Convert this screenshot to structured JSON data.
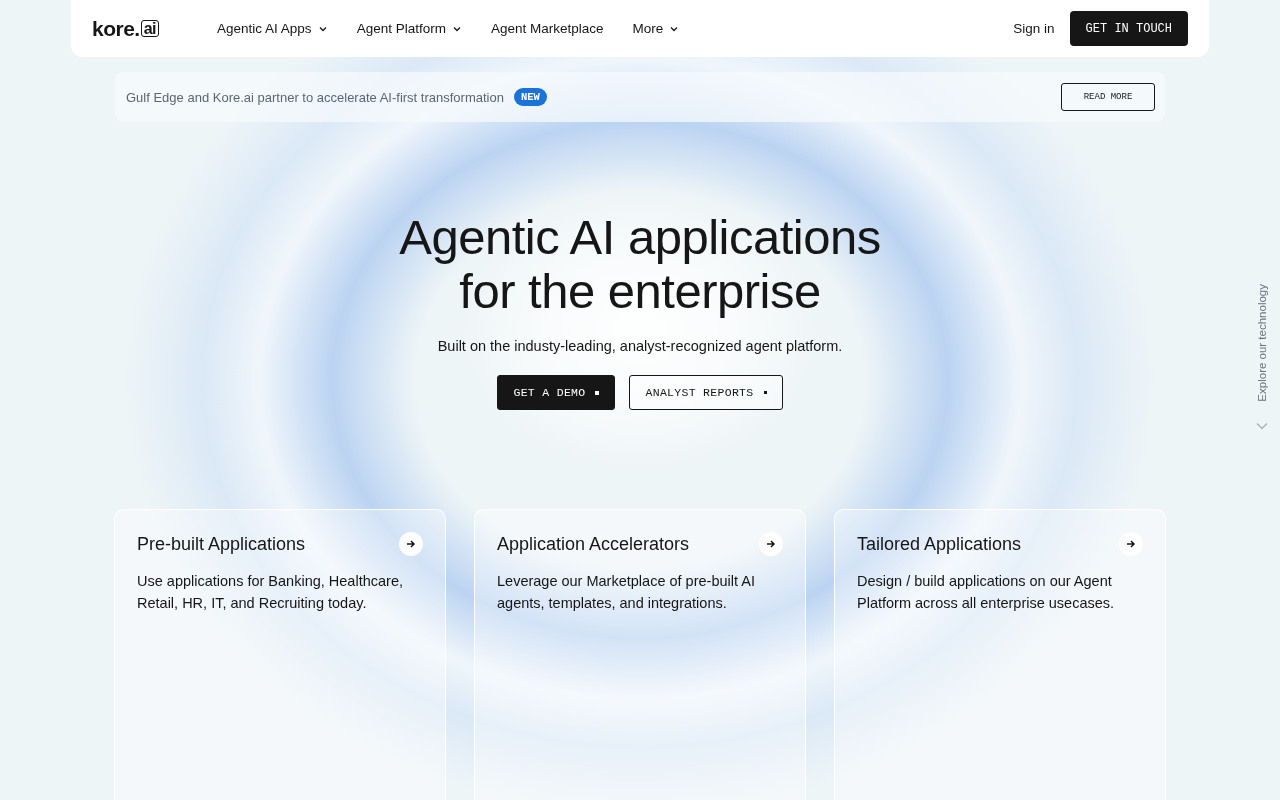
{
  "nav": {
    "logo": {
      "word": "kore.",
      "badge": "ai"
    },
    "links": [
      {
        "label": "Agentic AI Apps",
        "dropdown": true
      },
      {
        "label": "Agent Platform",
        "dropdown": true
      },
      {
        "label": "Agent Marketplace",
        "dropdown": false
      },
      {
        "label": "More",
        "dropdown": true
      }
    ],
    "sign_in": "Sign in",
    "cta": "GET IN TOUCH"
  },
  "announcement": {
    "text": "Gulf Edge and Kore.ai partner to accelerate AI-first transformation",
    "badge": "NEW",
    "button": "READ MORE"
  },
  "hero": {
    "title_lines": [
      "Agentic AI applications",
      "for the enterprise"
    ],
    "subtitle": "Built on the industy-leading, analyst-recognized agent platform.",
    "buttons": [
      {
        "label": "GET A DEMO",
        "kind": "primary"
      },
      {
        "label": "ANALYST REPORTS",
        "kind": "outline"
      }
    ]
  },
  "side_link": "Explore our technology",
  "cards": [
    {
      "title": "Pre-built Applications",
      "text": "Use applications for Banking, Healthcare, Retail, HR, IT, and Recruiting today."
    },
    {
      "title": "Application Accelerators",
      "text": "Leverage our Marketplace of pre-built AI agents, templates, and integrations."
    },
    {
      "title": "Tailored Applications",
      "text": "Design / build applications on our Agent Platform across all enterprise usecases."
    }
  ]
}
